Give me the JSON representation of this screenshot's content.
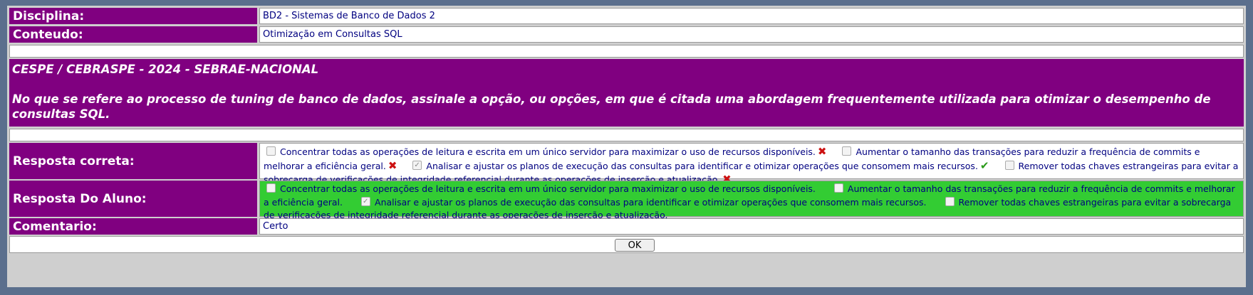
{
  "disciplina": {
    "label": "Disciplina:",
    "value": "BD2 - Sistemas de Banco de Dados 2"
  },
  "conteudo": {
    "label": "Conteudo:",
    "value": "Otimização em Consultas SQL"
  },
  "question": {
    "header": "CESPE / CEBRASPE - 2024 - SEBRAE-NACIONAL",
    "text": "No que se refere ao processo de tuning de banco de dados, assinale a opção, ou opções, em que é citada uma abordagem frequentemente utilizada para otimizar o desempenho de consultas SQL."
  },
  "options": [
    "Concentrar todas as operações de leitura e escrita em um único servidor para maximizar o uso de recursos disponíveis.",
    "Aumentar o tamanho das transações para reduzir a frequência de commits e melhorar a eficiência geral.",
    "Analisar e ajustar os planos de execução das consultas para identificar e otimizar operações que consomem mais recursos.",
    "Remover todas chaves estrangeiras para evitar a sobrecarga de verificações de integridade referencial durante as operações de inserção e atualização."
  ],
  "resposta_correta": {
    "label": "Resposta correta:",
    "checked": [
      false,
      false,
      true,
      false
    ],
    "marks": [
      "wrong-mark-icon",
      "wrong-mark-icon",
      "correct-mark-icon",
      "wrong-mark-icon"
    ]
  },
  "resposta_aluno": {
    "label": "Resposta Do Aluno:",
    "checked": [
      false,
      false,
      true,
      false
    ],
    "background": "#33cc33"
  },
  "comentario": {
    "label": "Comentario:",
    "value": "Certo"
  },
  "ok_button": "OK",
  "colors": {
    "label_bg": "#800080",
    "frame_bg": "#5b6f8d",
    "value_text": "#000080"
  }
}
